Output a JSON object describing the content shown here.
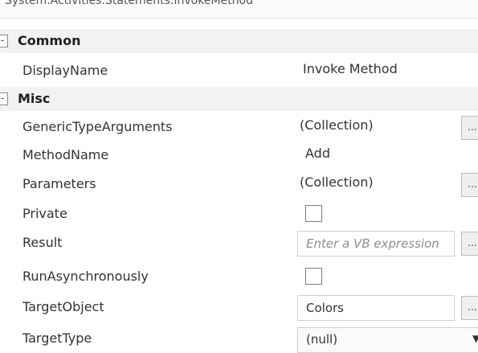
{
  "window": {
    "title": "System.Activities.Statements.InvokeMethod"
  },
  "categories": {
    "common": {
      "label": "Common",
      "toggle": "-"
    },
    "misc": {
      "label": "Misc",
      "toggle": "-"
    }
  },
  "properties": {
    "display_name": {
      "name": "DisplayName",
      "value": "Invoke Method"
    },
    "generic_type_arguments": {
      "name": "GenericTypeArguments",
      "value": "(Collection)",
      "button": "..."
    },
    "method_name": {
      "name": "MethodName",
      "value": "Add"
    },
    "parameters": {
      "name": "Parameters",
      "value": "(Collection)",
      "button": "..."
    },
    "private": {
      "name": "Private",
      "checked": false
    },
    "result": {
      "name": "Result",
      "placeholder": "Enter a VB expression",
      "button": "..."
    },
    "run_asynchronously": {
      "name": "RunAsynchronously",
      "checked": false
    },
    "target_object": {
      "name": "TargetObject",
      "value": "Colors",
      "button": "..."
    },
    "target_type": {
      "name": "TargetType",
      "value": "(null)"
    }
  },
  "colors": {
    "category_background": "#f2f2f2",
    "field_border": "#cfcfcf"
  }
}
